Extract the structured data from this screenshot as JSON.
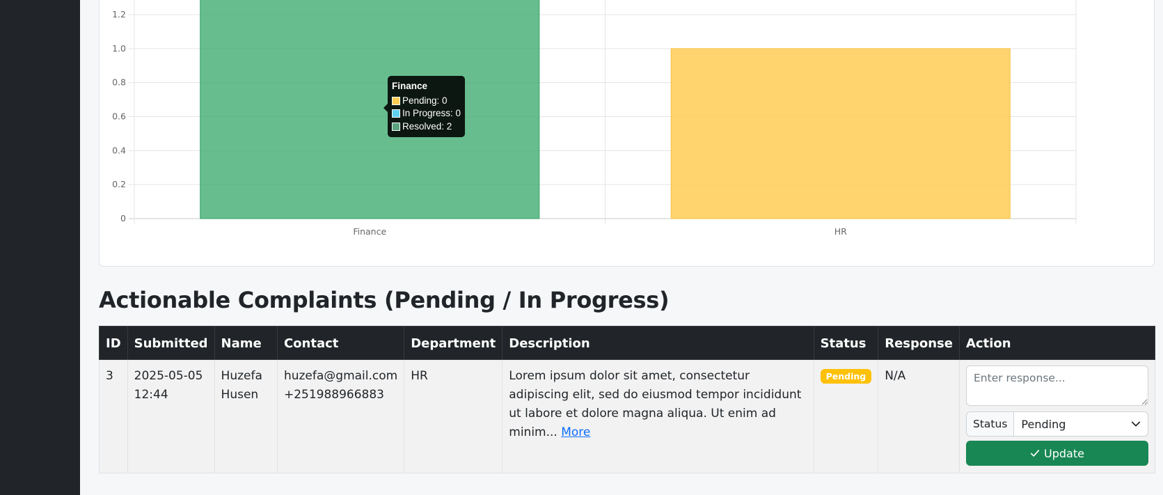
{
  "chart_data": {
    "type": "bar",
    "stacked": true,
    "categories": [
      "Finance",
      "HR"
    ],
    "series": [
      {
        "name": "Pending",
        "values": [
          0,
          1
        ],
        "color": "#ffcd56"
      },
      {
        "name": "In Progress",
        "values": [
          0,
          0
        ],
        "color": "#36a2eb"
      },
      {
        "name": "Resolved",
        "values": [
          2,
          0
        ],
        "color": "#4caf7d"
      }
    ],
    "y_ticks": [
      "0",
      "0.2",
      "0.4",
      "0.6",
      "0.8",
      "1.0",
      "1.2"
    ],
    "ylim": [
      0,
      1.2
    ],
    "grid": true,
    "tooltip": {
      "title": "Finance",
      "rows": [
        {
          "label": "Pending: 0",
          "color": "#ffcd56"
        },
        {
          "label": "In Progress: 0",
          "color": "#36a2eb"
        },
        {
          "label": "Resolved: 2",
          "color": "#4caf7d"
        }
      ]
    }
  },
  "section_title": "Actionable Complaints (Pending / In Progress)",
  "table": {
    "headers": {
      "id": "ID",
      "submitted": "Submitted",
      "name": "Name",
      "contact": "Contact",
      "department": "Department",
      "description": "Description",
      "status": "Status",
      "response": "Response",
      "action": "Action"
    },
    "rows": [
      {
        "id": "3",
        "submitted_date": "2025-05-05",
        "submitted_time": "12:44",
        "name_first": "Huzefa",
        "name_last": "Husen",
        "email": "huzefa@gmail.com",
        "phone": "+251988966883",
        "department": "HR",
        "description": "Lorem ipsum dolor sit amet, consectetur adipiscing elit, sed do eiusmod tempor incididunt ut labore et dolore magna aliqua. Ut enim ad minim...",
        "more_label": "More",
        "status": "Pending",
        "status_color": "#ffc107",
        "response": "N/A",
        "response_placeholder": "Enter response...",
        "status_prefix": "Status",
        "status_selected": "Pending",
        "update_label": "Update"
      }
    ]
  }
}
